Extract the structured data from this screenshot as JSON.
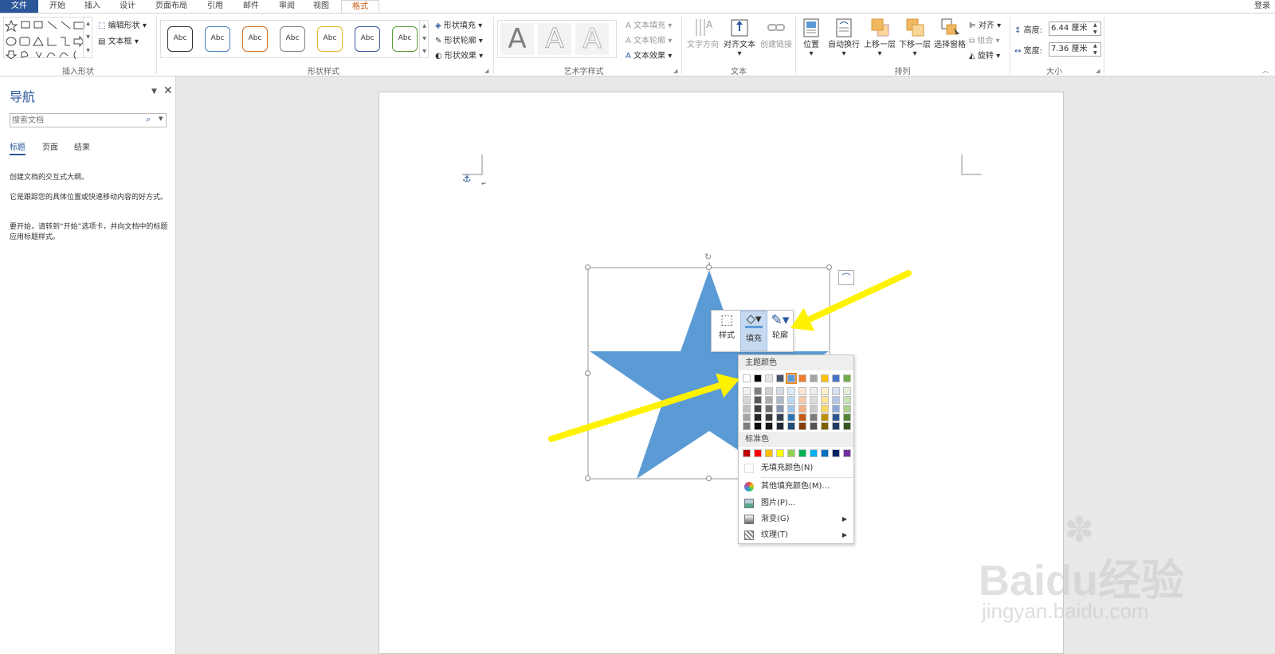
{
  "tabs": {
    "file": "文件",
    "home": "开始",
    "insert": "插入",
    "design": "设计",
    "layout": "页面布局",
    "references": "引用",
    "mailings": "邮件",
    "review": "审阅",
    "view": "视图",
    "format": "格式",
    "login": "登录"
  },
  "ribbon": {
    "insert_shapes": {
      "edit_shape": "编辑形状",
      "text_box": "文本框",
      "label": "插入形状"
    },
    "shape_styles": {
      "style_label": "Abc",
      "fill": "形状填充",
      "outline": "形状轮廓",
      "effects": "形状效果",
      "label": "形状样式",
      "swatches": [
        "#333333",
        "#4a7ebb",
        "#d0722b",
        "#7f7f7f",
        "#e3b320",
        "#36589a",
        "#5c9a3c"
      ]
    },
    "wordart": {
      "glyph": "A",
      "fill": "文本填充",
      "outline": "文本轮廓",
      "effects": "文本效果",
      "label": "艺术字样式"
    },
    "text": {
      "direction": "文字方向",
      "align": "对齐文本",
      "link": "创建链接",
      "label": "文本"
    },
    "arrange": {
      "position": "位置",
      "wrap": "自动换行",
      "forward": "上移一层",
      "backward": "下移一层",
      "selection": "选择窗格",
      "align": "对齐",
      "group": "组合",
      "rotate": "旋转",
      "label": "排列"
    },
    "size": {
      "height_label": "高度:",
      "height_value": "6.44 厘米",
      "width_label": "宽度:",
      "width_value": "7.36 厘米",
      "label": "大小"
    }
  },
  "nav": {
    "title": "导航",
    "search_placeholder": "搜索文档",
    "tabs": [
      "标题",
      "页面",
      "结果"
    ],
    "p1": "创建文档的交互式大纲。",
    "p2": "它是跟踪您的具体位置或快速移动内容的好方式。",
    "p3": "要开始，请转到“开始”选项卡，并向文档中的标题应用标题样式。"
  },
  "mini_toolbar": {
    "style": "样式",
    "fill": "填充",
    "outline": "轮廓"
  },
  "fill_menu": {
    "theme_header": "主题颜色",
    "theme_colors": [
      "#ffffff",
      "#000000",
      "#e7e6e6",
      "#44546a",
      "#5b9bd5",
      "#ed7d31",
      "#a5a5a5",
      "#ffc000",
      "#4472c4",
      "#70ad47"
    ],
    "theme_shades": [
      [
        "#f2f2f2",
        "#7f7f7f",
        "#d0cece",
        "#d6dce4",
        "#deebf6",
        "#fbe5d5",
        "#ededed",
        "#fff2cc",
        "#d9e2f3",
        "#e2efd9"
      ],
      [
        "#d8d8d8",
        "#595959",
        "#aeabab",
        "#adb9ca",
        "#bdd7ee",
        "#f7cbac",
        "#dbdbdb",
        "#fee599",
        "#b4c6e7",
        "#c5e0b3"
      ],
      [
        "#bfbfbf",
        "#3f3f3f",
        "#757070",
        "#8496b0",
        "#9dc3e6",
        "#f4b183",
        "#c9c9c9",
        "#ffd965",
        "#8eaadb",
        "#a8d08d"
      ],
      [
        "#a5a5a5",
        "#262626",
        "#3a3838",
        "#333f4f",
        "#2e75b5",
        "#c55a11",
        "#7b7b7b",
        "#bf9000",
        "#2f5496",
        "#538135"
      ],
      [
        "#7f7f7f",
        "#0c0c0c",
        "#171616",
        "#222a35",
        "#1e4e79",
        "#833c0b",
        "#525252",
        "#7f6000",
        "#1f3864",
        "#375623"
      ]
    ],
    "standard_header": "标准色",
    "standard_colors": [
      "#c00000",
      "#ff0000",
      "#ffc000",
      "#ffff00",
      "#92d050",
      "#00b050",
      "#00b0f0",
      "#0070c0",
      "#002060",
      "#7030a0"
    ],
    "no_fill": "无填充颜色(N)",
    "more_colors": "其他填充颜色(M)...",
    "picture": "图片(P)...",
    "gradient": "渐变(G)",
    "texture": "纹理(T)"
  },
  "shape": {
    "fill": "#5b9bd5"
  },
  "watermark": {
    "brand": "Baidu经验",
    "url": "jingyan.baidu.com"
  },
  "colors": {
    "accent": "#2b579a",
    "arrow": "#fff200",
    "active_tab": "#c55a11"
  }
}
